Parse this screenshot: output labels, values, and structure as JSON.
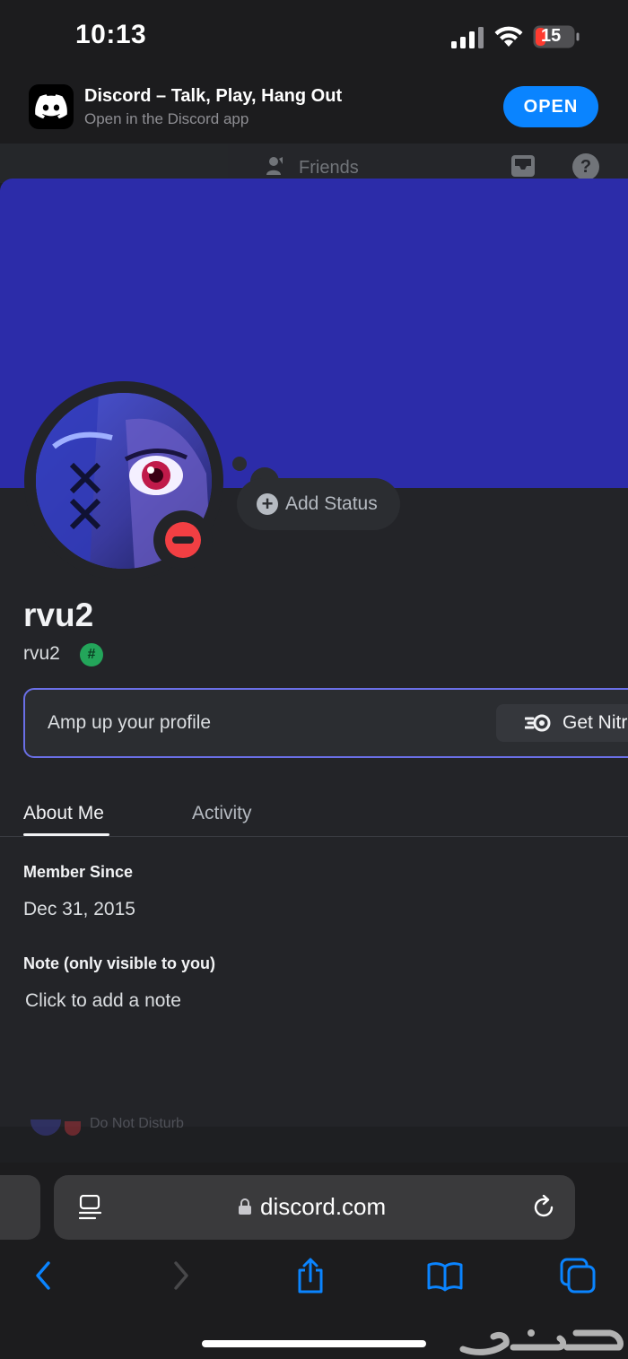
{
  "status_bar": {
    "time": "10:13",
    "battery": "15"
  },
  "smart_banner": {
    "app_title": "Discord – Talk, Play, Hang Out",
    "subtitle": "Open in the Discord app",
    "open_label": "OPEN"
  },
  "behind_header": {
    "friends_label": "Friends",
    "help_glyph": "?"
  },
  "profile": {
    "add_status_label": "Add Status",
    "display_name": "rvu2",
    "username": "rvu2",
    "badge_glyph": "#",
    "nitro_prompt": "Amp up your profile",
    "nitro_button": "Get Nitro",
    "tabs": [
      {
        "label": "About Me",
        "active": true
      },
      {
        "label": "Activity",
        "active": false
      }
    ],
    "member_since_label": "Member Since",
    "member_since_value": "Dec 31, 2015",
    "note_label": "Note (only visible to you)",
    "note_placeholder": "Click to add a note",
    "status": "do-not-disturb"
  },
  "behind_bottom": {
    "text": "Do Not Disturb"
  },
  "safari": {
    "url": "discord.com",
    "toolbar_icons": [
      "back-icon",
      "forward-icon",
      "share-icon",
      "bookmarks-icon",
      "tabs-icon"
    ]
  },
  "watermark": {
    "text": "حراج"
  },
  "colors": {
    "banner_blue": "#2c2ca9",
    "sheet_bg": "#232428",
    "dnd_red": "#f23f43",
    "accent_blue": "#0a84ff",
    "badge_green": "#23a55a"
  }
}
